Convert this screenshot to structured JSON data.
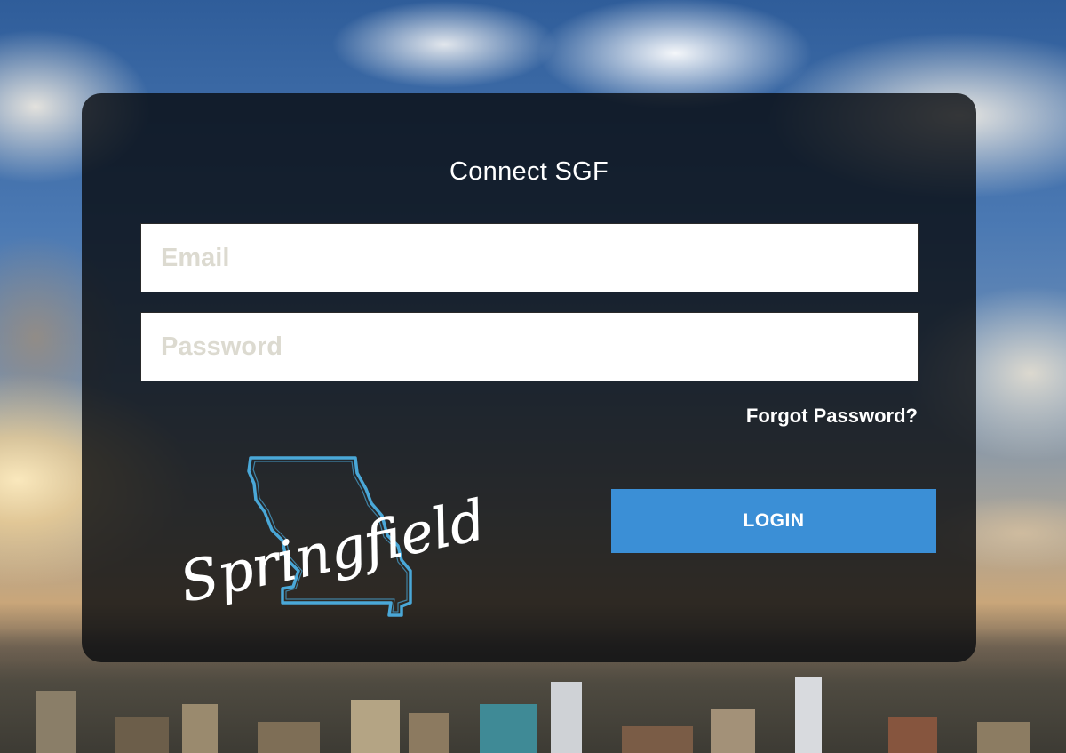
{
  "login": {
    "title": "Connect SGF",
    "email_placeholder": "Email",
    "password_placeholder": "Password",
    "forgot_label": "Forgot Password?",
    "login_label": "LOGIN"
  },
  "logo": {
    "text": "Springfield",
    "icon": "missouri-state-outline-icon"
  },
  "colors": {
    "accent": "#3b8fd6",
    "logo_outline": "#4aa8d8",
    "card_overlay": "rgba(8,10,14,0.80)"
  }
}
